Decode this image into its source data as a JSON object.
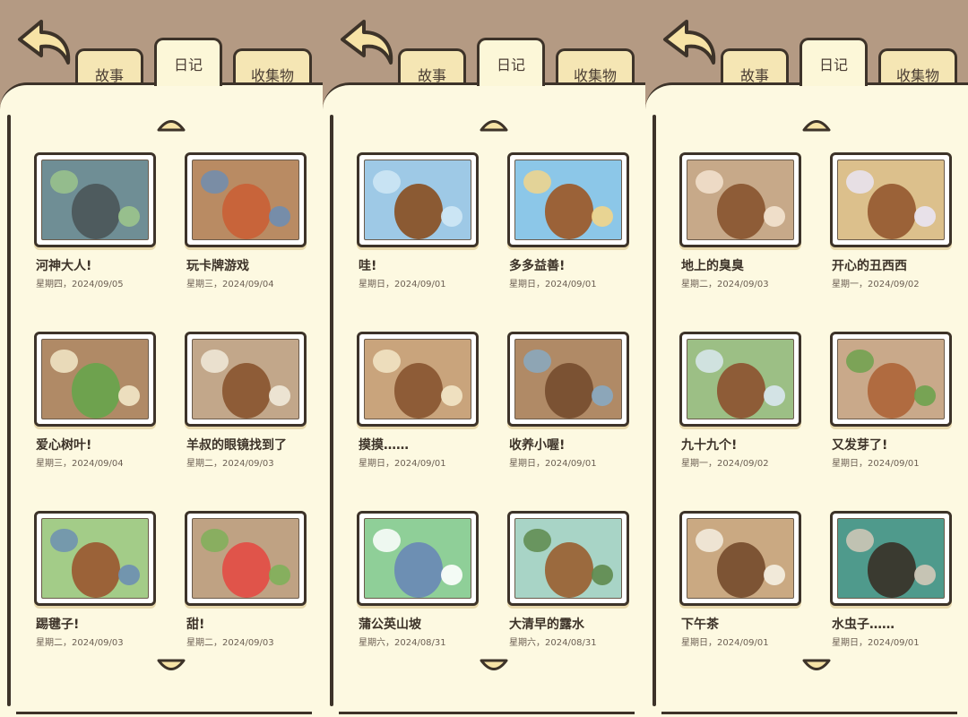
{
  "tabs": {
    "story": "故事",
    "diary": "日记",
    "collection": "收集物"
  },
  "pages": [
    {
      "entries": [
        {
          "title": "哇!",
          "date": "星期日，2024/09/01",
          "bg": "#9ec9e6",
          "fg": "#8b5a33",
          "accent": "#cfe8f5"
        },
        {
          "title": "多多益善!",
          "date": "星期日，2024/09/01",
          "bg": "#8cc7e8",
          "fg": "#9b6238",
          "accent": "#f2d58a"
        },
        {
          "title": "摸摸……",
          "date": "星期日，2024/09/01",
          "bg": "#c9a47c",
          "fg": "#8e5c37",
          "accent": "#f3e7c8"
        },
        {
          "title": "收养小喔!",
          "date": "星期日，2024/09/01",
          "bg": "#b08a66",
          "fg": "#7b5233",
          "accent": "#88a9c2"
        },
        {
          "title": "蒲公英山坡",
          "date": "星期六，2024/08/31",
          "bg": "#8fcf98",
          "fg": "#6d8fb3",
          "accent": "#ffffff"
        },
        {
          "title": "大清早的露水",
          "date": "星期六，2024/08/31",
          "bg": "#a8d4c6",
          "fg": "#9b6a3e",
          "accent": "#5e8a4c"
        }
      ]
    },
    {
      "entries": [
        {
          "title": "地上的臭臭",
          "date": "星期二，2024/09/03",
          "bg": "#c7a989",
          "fg": "#8e5c37",
          "accent": "#f3e3d0"
        },
        {
          "title": "开心的丑西西",
          "date": "星期一，2024/09/02",
          "bg": "#dcc08c",
          "fg": "#9b6238",
          "accent": "#e9e4f3"
        },
        {
          "title": "九十九个!",
          "date": "星期一，2024/09/02",
          "bg": "#9cbf85",
          "fg": "#8e5c37",
          "accent": "#d9e7ef"
        },
        {
          "title": "又发芽了!",
          "date": "星期日，2024/09/01",
          "bg": "#c9a98a",
          "fg": "#b06b40",
          "accent": "#6ea24e"
        },
        {
          "title": "下午茶",
          "date": "星期日，2024/09/01",
          "bg": "#caa982",
          "fg": "#7d5434",
          "accent": "#f5efe2"
        },
        {
          "title": "水虫子……",
          "date": "星期日，2024/09/01",
          "bg": "#4f9a8c",
          "fg": "#3a3a30",
          "accent": "#d3c9b8"
        }
      ]
    },
    {
      "entries": [
        {
          "title": "河神大人!",
          "date": "星期四，2024/09/05",
          "bg": "#6f8e95",
          "fg": "#4e5b5e",
          "accent": "#9bc48c"
        },
        {
          "title": "玩卡牌游戏",
          "date": "星期三，2024/09/04",
          "bg": "#b98b63",
          "fg": "#c8643a",
          "accent": "#6f8db0"
        },
        {
          "title": "爱心树叶!",
          "date": "星期三，2024/09/04",
          "bg": "#b08a66",
          "fg": "#6ea24e",
          "accent": "#f3e7c8"
        },
        {
          "title": "羊叔的眼镜找到了",
          "date": "星期二，2024/09/03",
          "bg": "#c2a78a",
          "fg": "#8e5c37",
          "accent": "#f1ead9"
        },
        {
          "title": "踢毽子!",
          "date": "星期二，2024/09/03",
          "bg": "#a3cc88",
          "fg": "#9b6238",
          "accent": "#6d8fb3"
        },
        {
          "title": "甜!",
          "date": "星期二，2024/09/03",
          "bg": "#bfa283",
          "fg": "#e0544a",
          "accent": "#7fb05a"
        }
      ]
    }
  ]
}
